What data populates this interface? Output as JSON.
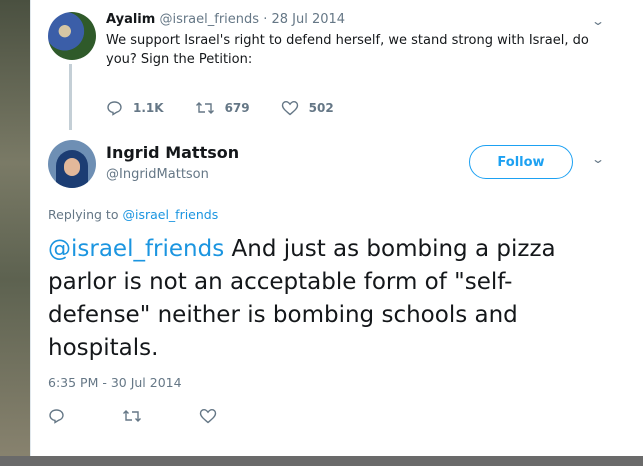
{
  "parent_tweet": {
    "name": "Ayalim",
    "handle": "@israel_friends",
    "separator": "·",
    "date": "28 Jul 2014",
    "text": "We support Israel's right to defend herself, we stand strong with Israel, do you? Sign the Petition:",
    "replies": "1.1K",
    "retweets": "679",
    "likes": "502"
  },
  "main_tweet": {
    "name": "Ingrid Mattson",
    "handle": "@IngridMattson",
    "follow_label": "Follow",
    "replying_prefix": "Replying to",
    "replying_handle": "@israel_friends",
    "mention": "@israel_friends",
    "text": " And just as bombing a pizza parlor is not an acceptable form of \"self-defense\" neither is bombing schools and hospitals.",
    "timestamp": "6:35 PM - 30 Jul 2014"
  },
  "colors": {
    "accent": "#1da1f2",
    "link": "#1b95e0",
    "muted": "#657786",
    "text": "#14171a"
  }
}
